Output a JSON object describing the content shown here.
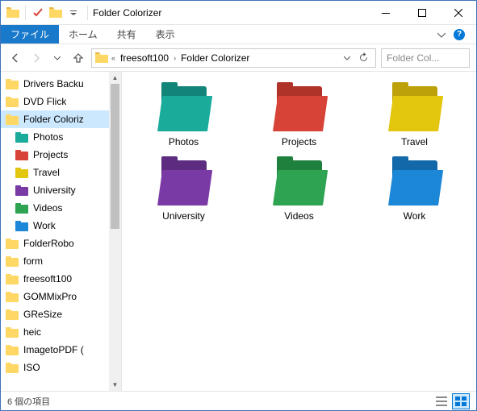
{
  "window": {
    "title": "Folder Colorizer"
  },
  "ribbon": {
    "file": "ファイル",
    "home": "ホーム",
    "share": "共有",
    "view": "表示"
  },
  "breadcrumb": {
    "seg1": "freesoft100",
    "seg2": "Folder Colorizer"
  },
  "search": {
    "placeholder": "Folder Col..."
  },
  "tree": [
    {
      "label": "Drivers Backu",
      "color": "#ffd765",
      "indent": 0,
      "sel": false
    },
    {
      "label": "DVD Flick",
      "color": "#ffd765",
      "indent": 0,
      "sel": false
    },
    {
      "label": "Folder Coloriz",
      "color": "#ffd765",
      "indent": 0,
      "sel": true
    },
    {
      "label": "Photos",
      "color": "#1aab9b",
      "indent": 1,
      "sel": false
    },
    {
      "label": "Projects",
      "color": "#d84338",
      "indent": 1,
      "sel": false
    },
    {
      "label": "Travel",
      "color": "#e3c60e",
      "indent": 1,
      "sel": false
    },
    {
      "label": "University",
      "color": "#7a3aa5",
      "indent": 1,
      "sel": false
    },
    {
      "label": "Videos",
      "color": "#2ea351",
      "indent": 1,
      "sel": false
    },
    {
      "label": "Work",
      "color": "#1b87d6",
      "indent": 1,
      "sel": false
    },
    {
      "label": "FolderRobo",
      "color": "#ffd765",
      "indent": 0,
      "sel": false
    },
    {
      "label": "form",
      "color": "#ffd765",
      "indent": 0,
      "sel": false
    },
    {
      "label": "freesoft100",
      "color": "#ffd765",
      "indent": 0,
      "sel": false
    },
    {
      "label": "GOMMixPro",
      "color": "#ffd765",
      "indent": 0,
      "sel": false
    },
    {
      "label": "GReSize",
      "color": "#ffd765",
      "indent": 0,
      "sel": false
    },
    {
      "label": "heic",
      "color": "#ffd765",
      "indent": 0,
      "sel": false
    },
    {
      "label": "ImagetoPDF (",
      "color": "#ffd765",
      "indent": 0,
      "sel": false
    },
    {
      "label": "ISO",
      "color": "#ffd765",
      "indent": 0,
      "sel": false
    }
  ],
  "items": [
    {
      "label": "Photos",
      "color": "#1aab9b",
      "dark": "#138578"
    },
    {
      "label": "Projects",
      "color": "#d84338",
      "dark": "#b0332a"
    },
    {
      "label": "Travel",
      "color": "#e3c60e",
      "dark": "#bda10a"
    },
    {
      "label": "University",
      "color": "#7a3aa5",
      "dark": "#5d2b80"
    },
    {
      "label": "Videos",
      "color": "#2ea351",
      "dark": "#1f7f3c"
    },
    {
      "label": "Work",
      "color": "#1b87d6",
      "dark": "#1268a9"
    }
  ],
  "status": {
    "count": "6 個の項目"
  }
}
